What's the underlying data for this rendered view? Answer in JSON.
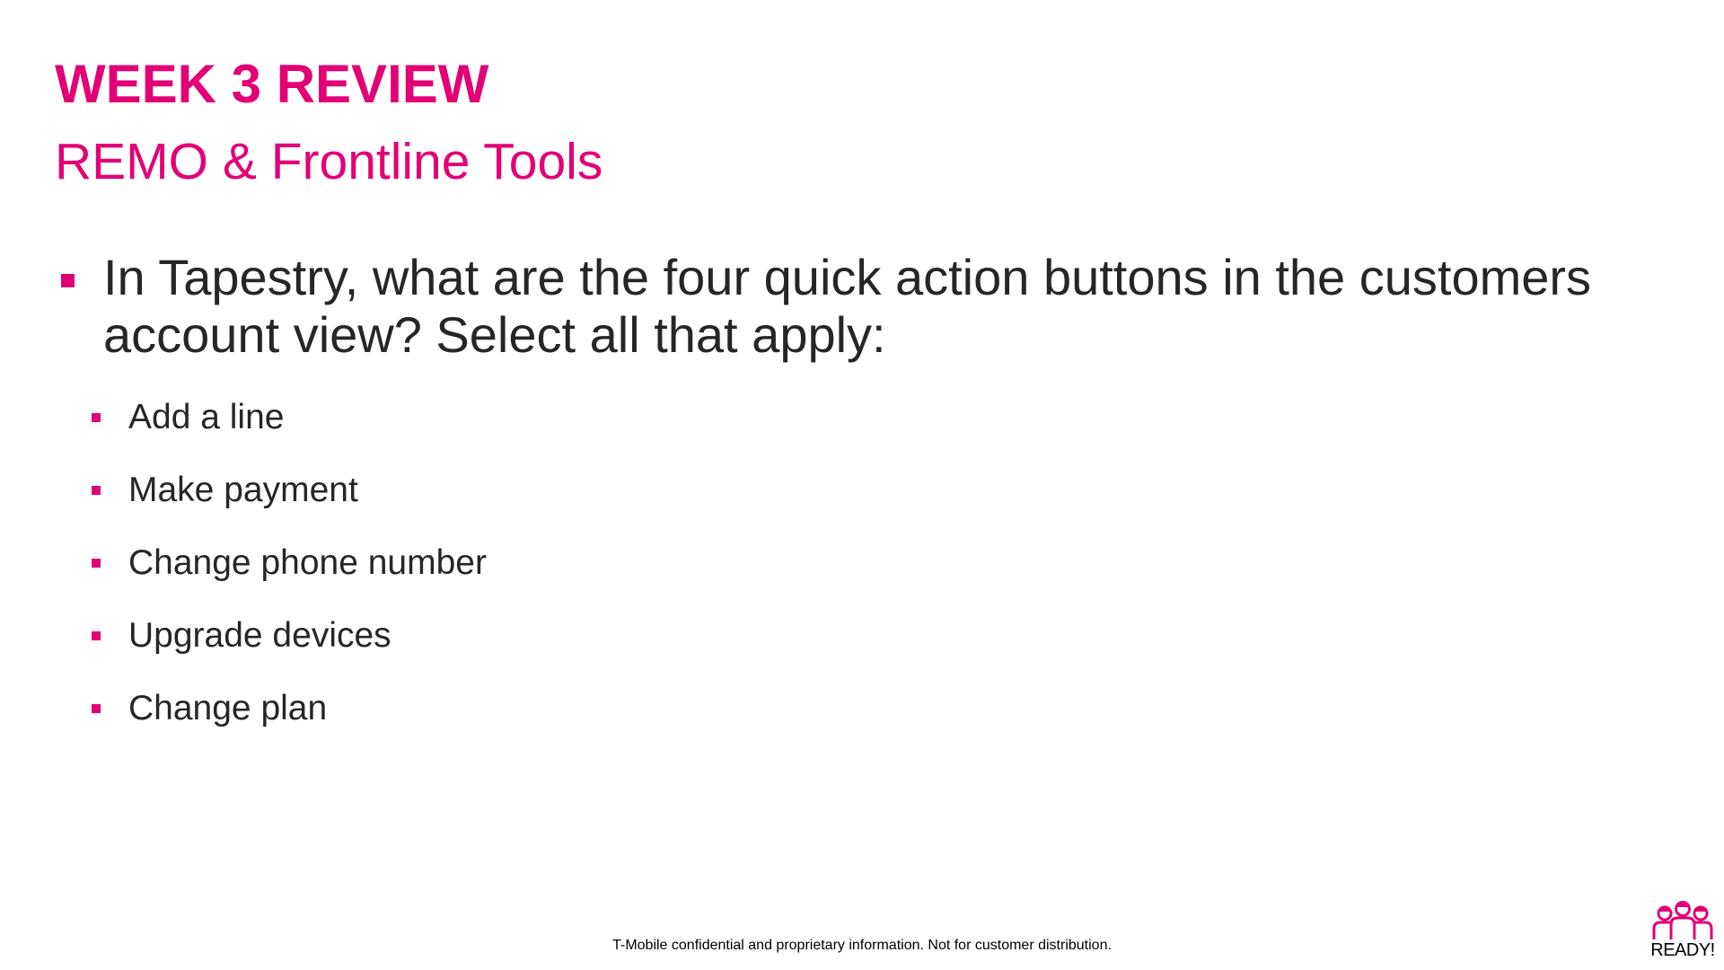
{
  "slide": {
    "title": "WEEK 3 REVIEW",
    "subtitle": "REMO & Frontline Tools",
    "question": "In Tapestry, what are the four quick action buttons in the customers account view? Select all that apply:",
    "options": [
      "Add a line",
      "Make payment",
      "Change phone number",
      "Upgrade devices",
      "Change plan"
    ]
  },
  "footer": {
    "disclaimer": "T-Mobile confidential and proprietary information. Not for customer distribution."
  },
  "logo": {
    "icon": "people-group-icon",
    "text": "READY!"
  },
  "colors": {
    "accent": "#e20074",
    "body_text": "#262626",
    "background": "#ffffff"
  }
}
